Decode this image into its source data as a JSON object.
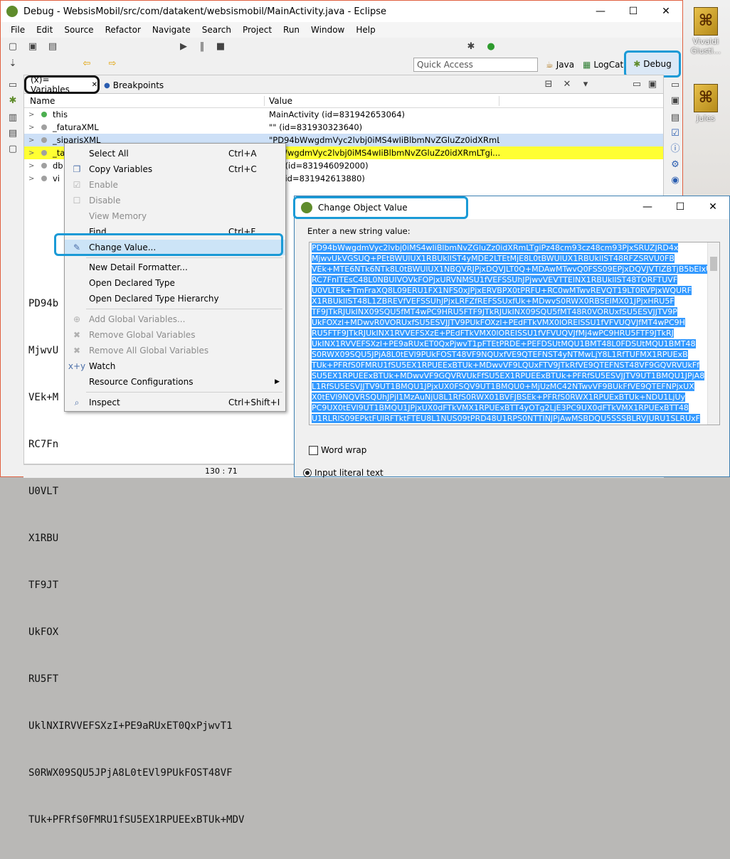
{
  "window": {
    "title": "Debug - WebsisMobil/src/com/datakent/websismobil/MainActivity.java - Eclipse",
    "minimize": "—",
    "maximize": "☐",
    "close": "✕"
  },
  "menu": [
    "File",
    "Edit",
    "Source",
    "Refactor",
    "Navigate",
    "Search",
    "Project",
    "Run",
    "Window",
    "Help"
  ],
  "toolbar": {
    "quick_access_placeholder": "Quick Access",
    "java_label": "Java",
    "logcat_label": "LogCat",
    "debug_label": "Debug"
  },
  "desktop": {
    "icon1": "Vivaldi Giusti...",
    "icon2": "Jules"
  },
  "tabs": {
    "variables": "(x)= Variables",
    "variables_close": "✕",
    "breakpoints": "Breakpoints"
  },
  "columns": {
    "name": "Name",
    "value": "Value"
  },
  "rows": [
    {
      "name": "this",
      "value": "MainActivity  (id=831942653064)"
    },
    {
      "name": "_faturaXML",
      "value": "\"\" (id=831930323640)"
    },
    {
      "name": "_siparisXML",
      "value": "\"PD94bWwgdmVyc2lvbj0iMS4wIiBlbmNvZGluZz0idXRmLTgi..."
    },
    {
      "name": "_ta",
      "value": "4bWwgdmVyc2lvbj0iMS4wIiBlbmNvZGluZz0idXRmLTgi..."
    },
    {
      "name": "db",
      "value": "ass  (id=831946092000)"
    },
    {
      "name": "vi",
      "value": "on  (id=831942613880)"
    }
  ],
  "detail_lines": [
    "PD94b",
    "MjwvU",
    "VEk+M",
    "RC7Fn",
    "U0VLT",
    "X1RBU",
    "TF9JT",
    "UkFOX",
    "RU5FT",
    "UklNXIRVVEFSXzI+PE9aRUxET0QxPjwvT1",
    "S0RWX09SQU5JPjA8L0tEVl9PUkFOST48VF",
    "TUk+PFRfS0FMRU1fSU5EX1RPUEExBTUk+MDV"
  ],
  "status": {
    "position": "130 : 71"
  },
  "context_menu": {
    "items": [
      {
        "label": "Select All",
        "accel": "Ctrl+A",
        "icon": "",
        "disabled": false
      },
      {
        "label": "Copy Variables",
        "accel": "Ctrl+C",
        "icon": "copy-icon",
        "disabled": false
      },
      {
        "label": "Enable",
        "accel": "",
        "icon": "check-icon",
        "disabled": true
      },
      {
        "label": "Disable",
        "accel": "",
        "icon": "square-icon",
        "disabled": true
      },
      {
        "label": "View Memory",
        "accel": "",
        "icon": "",
        "disabled": true
      },
      {
        "label": "Find...",
        "accel": "Ctrl+F",
        "icon": "",
        "disabled": false
      },
      {
        "label": "Change Value...",
        "accel": "",
        "icon": "edit-icon",
        "disabled": false
      },
      {
        "label": "New Detail Formatter...",
        "accel": "",
        "icon": "",
        "disabled": false
      },
      {
        "label": "Open Declared Type",
        "accel": "",
        "icon": "",
        "disabled": false
      },
      {
        "label": "Open Declared Type Hierarchy",
        "accel": "",
        "icon": "",
        "disabled": false
      },
      {
        "label": "Add Global Variables...",
        "accel": "",
        "icon": "add-icon",
        "disabled": true
      },
      {
        "label": "Remove Global Variables",
        "accel": "",
        "icon": "remove-icon",
        "disabled": true
      },
      {
        "label": "Remove All Global Variables",
        "accel": "",
        "icon": "remove-all-icon",
        "disabled": true
      },
      {
        "label": "Watch",
        "accel": "",
        "icon": "watch-icon",
        "disabled": false
      },
      {
        "label": "Resource Configurations",
        "accel": "",
        "icon": "",
        "disabled": false
      },
      {
        "label": "Inspect",
        "accel": "Ctrl+Shift+I",
        "icon": "inspect-icon",
        "disabled": false
      }
    ],
    "submenu_arrow": "▶"
  },
  "dialog": {
    "title": "Change Object Value",
    "prompt": "Enter a new string value:",
    "lines": [
      "PD94bWwgdmVyc2lvbj0iMS4wIiBlbmNvZGluZz0idXRmLTgiPz48cm93cz48cm93PjxSRUZJRD4x",
      "MjwvUkVGSUQ+PEtBWUlUX1RBUklIST4yMDE2LTEtMjE8L0tBWUlUX1RBUklIST48RFZSRVU0FB",
      "VEk+MTE6NTk6NTk8L0tBWUlUX1NBQVRJPjxDQVJLT0Q+MDAwMTwvQ0FSS09EPjxDQVJVTlZBTjB5bEIxU",
      "RC7FnITEsC48L0NBUIVOVkFOPjxURVNMSU1fVEFSSUhJPjwvVEVTTElNX1RBUklIST48TORFTUVF",
      "U0VLTEk+TmFraXQ8L09ERU1FX1NFS0xJPjxERVBPX0tPRFU+RC0wMTwvREVQT19LT0RVPjxWQURF",
      "X1RBUklIST48L1ZBREVfVEFSSUhJPjxLRFZfREFSSUxfUk+MDwvS0RWX0RBSEIMX01JPjxHRU5F",
      "TF9JTkRJUkINX09SQU5fMT4wPC9HRU5FTF9JTkRJUkINX09SQU5fMT48R0VORUxfSU5ESVJJTV9P",
      "UkFOXzl+MDwvR0VORUxfSU5ESVJJTV9PUkFOXzl+PEdFTkVMX0lOREISSU1fVFVUQVJfMT4wPC9H",
      "RU5FTF9JTkRJUkINX1RVVEFSXzE+PEdFTkVMX0lOREISSU1fVFVUQVJfMj4wPC9HRU5FTF9JTkRJ",
      "UkINX1RVVEFSXzI+PE9aRUxET0QxPjwvT1pFTEtPRDE+PEFDSUtMQU1BMT48L0FDSUtMQU1BMT48",
      "S0RWX09SQU5JPjA8L0tEVl9PUkFOST48VF9NQUxfVE9QTEFNST4yNTMwLjY8L1RfTUFMX1RPUExB",
      "TUk+PFRfS0FMRU1fSU5EX1RPUEExBTUk+MDwvVF9LQUxFTV9JTkRfVE9QTEFNST48VF9GQVRVUkFf",
      "SU5EX1RPUEExBTUk+MDwvVF9GQVRVUkFfSU5EX1RPUEExBTUk+PFRfSU5ESVJJTV9UT1BMQU1JPjA8",
      "L1RfSU5ESVJJTV9UT1BMQU1JPjxUX0FSQV9UT1BMQU0+MjUzMC42NTwvVF9BUkFfVE9QTEFNPjxUX",
      "X0tEVl9NQVRSQUhJPjI1MzAuNjU8L1RfS0RWX01BVFJBSEk+PFRfS0RWX1RPUExBTUk+NDU1LjUy",
      "PC9UX0tEVl9UT1BMQU1JPjxUX0dFTkVMX1RPUExBTT4yOTg2LjE3PC9UX0dFTkVMX1RPUExBTT48",
      "U1RLRlS09EPktFUlRFTktFTEU8L1NUS09tPRD48U1RPS0NTTINJPjAwMSBDQU5SSSBLRVJURU1SLRUxF"
    ],
    "word_wrap_label": "Word wrap",
    "radio_label": "Input literal text"
  }
}
